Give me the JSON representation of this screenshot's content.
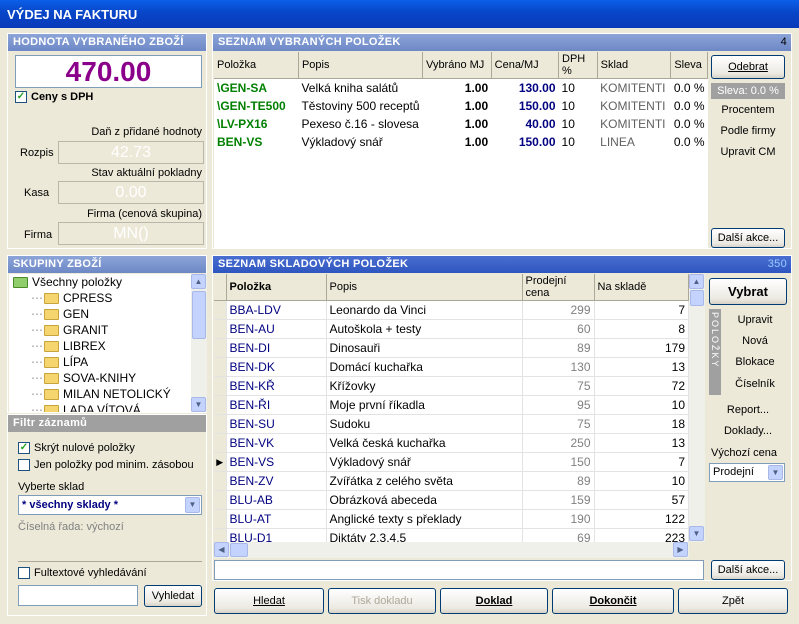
{
  "window": {
    "title": "VÝDEJ NA FAKTURU"
  },
  "value_panel": {
    "header": "HODNOTA VYBRANÉHO ZBOŽÍ",
    "total": "470.00",
    "prices_with_vat": "Ceny s DPH",
    "vat_label": "Daň z přidané hodnoty",
    "breakdown_label": "Rozpis",
    "vat_value": "42.73",
    "cash_state_label": "Stav aktuální pokladny",
    "cash_label": "Kasa",
    "cash_value": "0.00",
    "company_label": "Firma (cenová skupina)",
    "firm_label": "Firma",
    "firm_value": "MN()"
  },
  "selected": {
    "header": "SEZNAM VYBRANÝCH POLOŽEK",
    "count": "4",
    "columns": [
      "Položka",
      "Popis",
      "Vybráno MJ",
      "Cena/MJ",
      "DPH %",
      "Sklad",
      "Sleva"
    ],
    "rows": [
      {
        "item": "\\GEN-SA",
        "desc": "Velká kniha salátů",
        "qty": "1.00",
        "price": "130.00",
        "vat": "10",
        "store": "KOMITENTI",
        "disc": "0.0 %"
      },
      {
        "item": "\\GEN-TE500",
        "desc": "Těstoviny 500 receptů",
        "qty": "1.00",
        "price": "150.00",
        "vat": "10",
        "store": "KOMITENTI",
        "disc": "0.0 %"
      },
      {
        "item": "\\LV-PX16",
        "desc": "Pexeso č.16 - slovesa",
        "qty": "1.00",
        "price": "40.00",
        "vat": "10",
        "store": "KOMITENTI",
        "disc": "0.0 %"
      },
      {
        "item": "BEN-VS",
        "desc": "Výkladový snář",
        "qty": "1.00",
        "price": "150.00",
        "vat": "10",
        "store": "LINEA",
        "disc": "0.0 %"
      }
    ],
    "buttons": {
      "remove": "Odebrat",
      "discount": "Sleva: 0.0 %",
      "percent": "Procentem",
      "by_firm": "Podle firmy",
      "edit_price": "Upravit CM",
      "more": "Další akce..."
    }
  },
  "groups": {
    "header": "SKUPINY ZBOŽÍ",
    "root": "Všechny položky",
    "items": [
      "CPRESS",
      "GEN",
      "GRANIT",
      "LIBREX",
      "LÍPA",
      "SOVA-KNIHY",
      "MILAN NETOLICKÝ",
      "LADA VÍTOVÁ"
    ]
  },
  "filter": {
    "header": "Filtr záznamů",
    "hide_zero": "Skrýt nulové položky",
    "below_min": "Jen položky pod minim. zásobou",
    "store_label": "Vyberte sklad",
    "store_value": "* všechny sklady *",
    "series": "Číselná řada: výchozí",
    "fulltext": "Fultextové vyhledávání",
    "search_btn": "Vyhledat"
  },
  "stock": {
    "header": "SEZNAM SKLADOVÝCH POLOŽEK",
    "count": "350",
    "columns": [
      "Položka",
      "Popis",
      "Prodejní cena",
      "Na skladě"
    ],
    "rows": [
      {
        "item": "BBA-LDV",
        "desc": "Leonardo da Vinci",
        "price": "299",
        "qty": "7"
      },
      {
        "item": "BEN-AU",
        "desc": "Autoškola + testy",
        "price": "60",
        "qty": "8"
      },
      {
        "item": "BEN-DI",
        "desc": "Dinosauři",
        "price": "89",
        "qty": "179"
      },
      {
        "item": "BEN-DK",
        "desc": "Domácí kuchařka",
        "price": "130",
        "qty": "13"
      },
      {
        "item": "BEN-KŘ",
        "desc": "Křížovky",
        "price": "75",
        "qty": "72"
      },
      {
        "item": "BEN-ŘI",
        "desc": "Moje první říkadla",
        "price": "95",
        "qty": "10"
      },
      {
        "item": "BEN-SU",
        "desc": "Sudoku",
        "price": "75",
        "qty": "18"
      },
      {
        "item": "BEN-VK",
        "desc": "Velká česká kuchařka",
        "price": "250",
        "qty": "13"
      },
      {
        "item": "BEN-VS",
        "desc": "Výkladový snář",
        "price": "150",
        "qty": "7"
      },
      {
        "item": "BEN-ZV",
        "desc": "Zvířátka z celého světa",
        "price": "89",
        "qty": "10"
      },
      {
        "item": "BLU-AB",
        "desc": "Obrázková abeceda",
        "price": "159",
        "qty": "57"
      },
      {
        "item": "BLU-AT",
        "desc": "Anglické texty s překlady",
        "price": "190",
        "qty": "122"
      },
      {
        "item": "BLU-D1",
        "desc": "Diktáty 2,3,4,5",
        "price": "69",
        "qty": "223"
      }
    ],
    "buttons": {
      "select": "Vybrat",
      "side_label": "POLOŽKY",
      "edit": "Upravit",
      "new": "Nová",
      "block": "Blokace",
      "codebook": "Číselník",
      "report": "Report...",
      "docs": "Doklady...",
      "default_price_label": "Výchozí cena",
      "default_price": "Prodejní",
      "more": "Další akce..."
    }
  },
  "footer": {
    "search": "Hledat",
    "print": "Tisk dokladu",
    "doc": "Doklad",
    "finish": "Dokončit",
    "back": "Zpět"
  }
}
